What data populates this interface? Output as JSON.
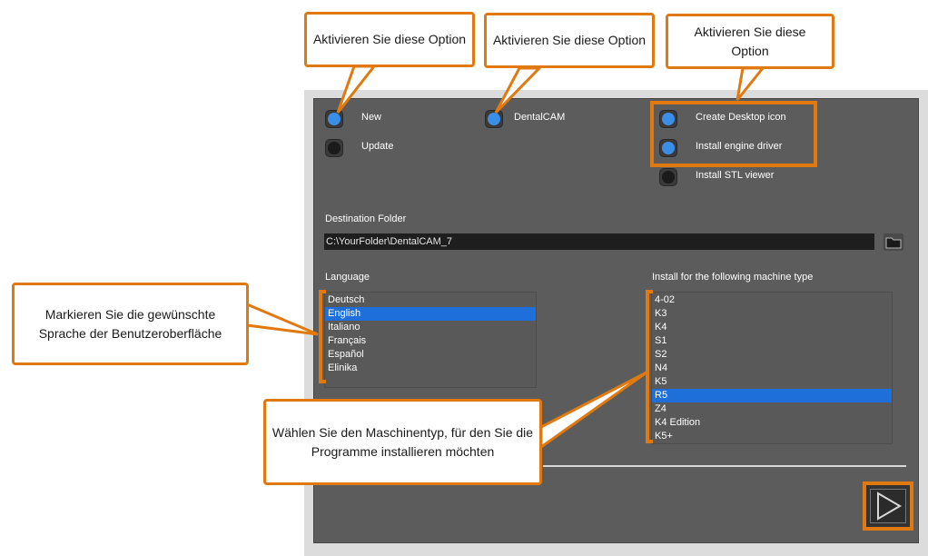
{
  "installer": {
    "options": {
      "new": {
        "label": "New",
        "selected": true
      },
      "update": {
        "label": "Update",
        "selected": false
      },
      "dentalcam": {
        "label": "DentalCAM",
        "selected": true
      },
      "create_desktop_icon": {
        "label": "Create Desktop icon",
        "selected": true
      },
      "install_engine_driver": {
        "label": "Install engine driver",
        "selected": true
      },
      "install_stl_viewer": {
        "label": "Install STL viewer",
        "selected": false
      }
    },
    "destination": {
      "label": "Destination Folder",
      "value": "C:\\YourFolder\\DentalCAM_7",
      "browse_icon": "folder-icon"
    },
    "language": {
      "label": "Language",
      "items": [
        "Deutsch",
        "English",
        "Italiano",
        "Français",
        "Español",
        "Elinika"
      ],
      "selected": "English"
    },
    "machine": {
      "label": "Install for the following machine type",
      "items": [
        "4-02",
        "K3",
        "K4",
        "S1",
        "S2",
        "N4",
        "K5",
        "R5",
        "Z4",
        "K4 Edition",
        "K5+"
      ],
      "selected": "R5"
    },
    "next_icon": "play-icon"
  },
  "annotations": {
    "callout1": "Aktivieren Sie diese Option",
    "callout2": "Aktivieren Sie diese Option",
    "callout3": "Aktivieren Sie diese Option",
    "callout_language": "Markieren Sie die gewünschte Sprache der Benutzeroberfläche",
    "callout_machine": "Wählen Sie den Maschinentyp, für den Sie die Programme installieren möchten"
  },
  "colors": {
    "accent_highlight": "#e07a10",
    "selection": "#1e6fd9",
    "radio_on": "#3a8ee6",
    "panel": "#5c5c5c"
  }
}
